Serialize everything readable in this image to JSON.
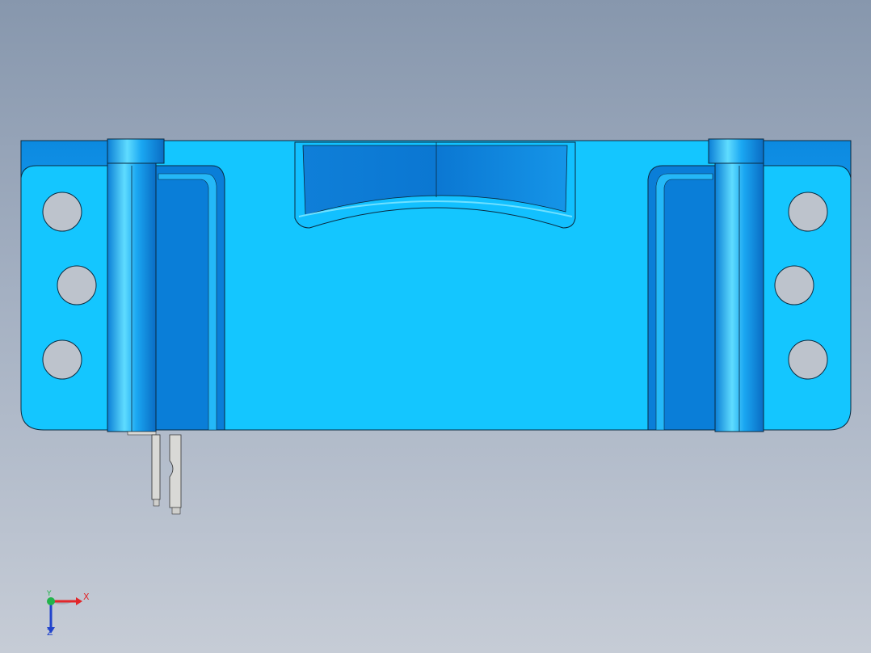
{
  "viewport": {
    "background_top": "#8797ad",
    "background_bottom": "#c6ccd6"
  },
  "model": {
    "part_color": "#14c6ff",
    "part_dark": "#0a86dc",
    "part_mid": "#0fa8f0",
    "edge_color": "#0a2a40",
    "pin_color": "#d9d9d6",
    "hole_fill": "#bdc3cc",
    "mounting_hole_count": 6
  },
  "triad": {
    "x_label": "X",
    "y_label": "Y",
    "z_label": "Z",
    "x_color": "#e2262a",
    "y_color": "#22b44b",
    "z_color": "#2244cc"
  }
}
